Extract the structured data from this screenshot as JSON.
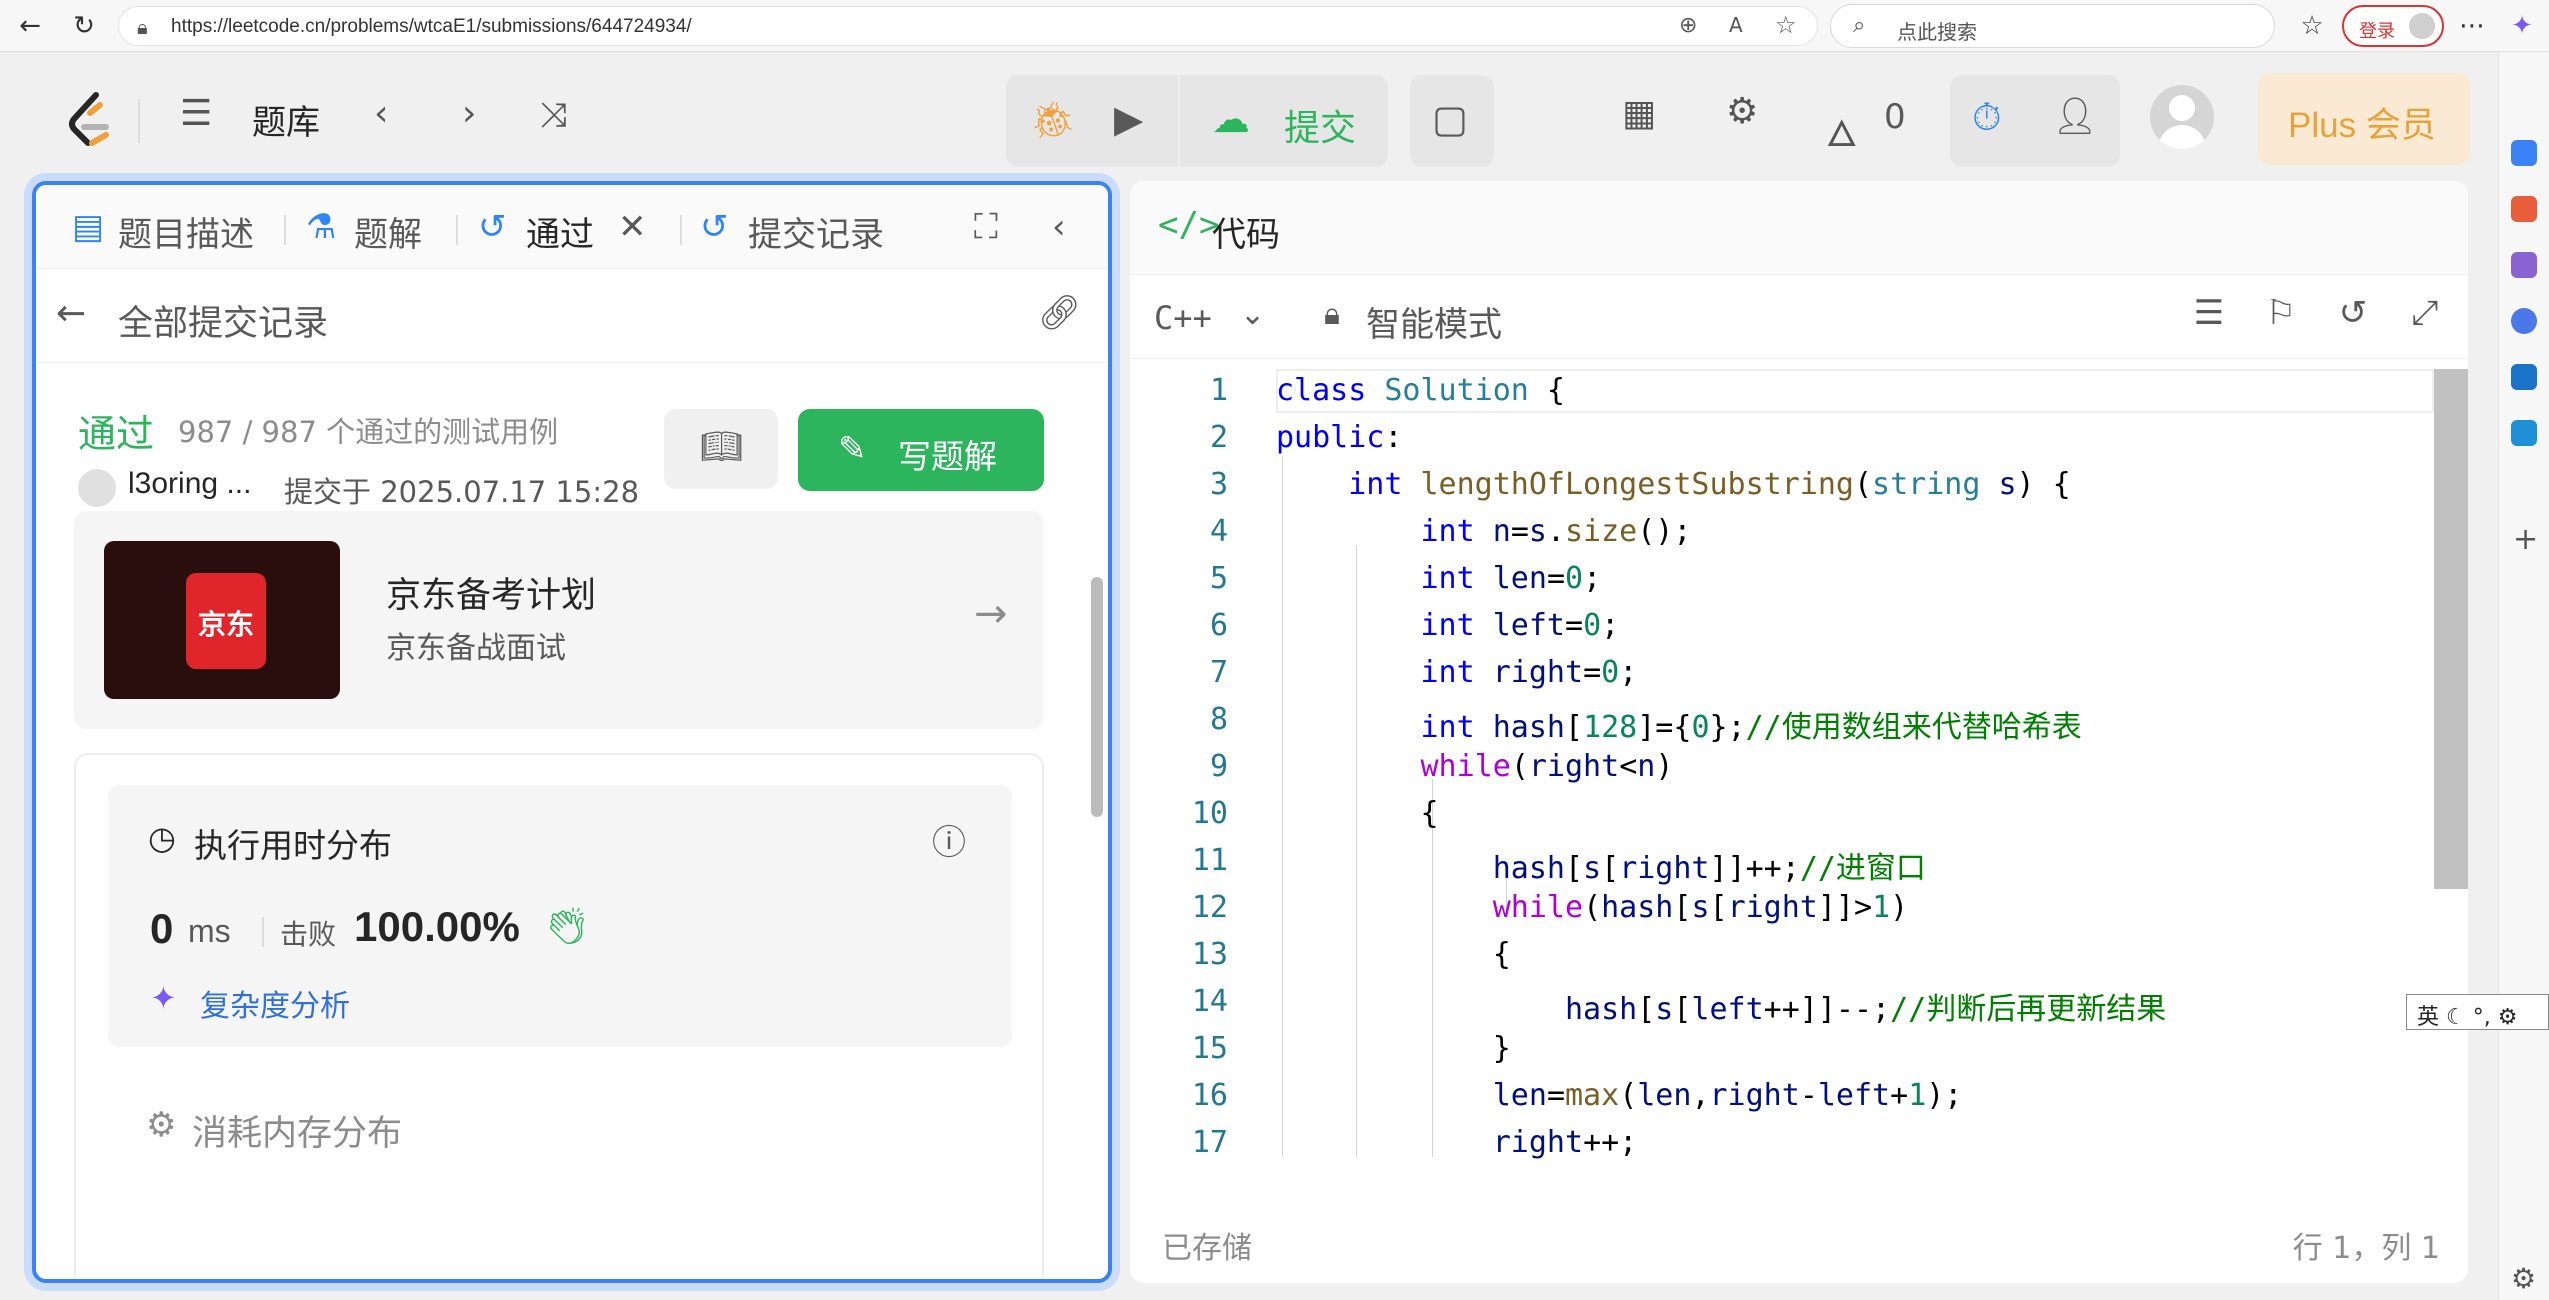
{
  "browser": {
    "url": "https://leetcode.cn/problems/wtcaE1/submissions/644724934/",
    "search_placeholder": "点此搜索",
    "login_label": "登录"
  },
  "topnav": {
    "problem_bank": "题库",
    "submit_label": "提交",
    "streak_count": "0",
    "plus_label": "Plus 会员"
  },
  "left": {
    "tabs": [
      {
        "label": "题目描述"
      },
      {
        "label": "题解"
      },
      {
        "label": "通过"
      },
      {
        "label": "提交记录"
      }
    ],
    "subhead": "全部提交记录",
    "status": "通过",
    "status_detail": "987 / 987 个通过的测试用例",
    "user": "l3oring ...",
    "submitted_at": "提交于 2025.07.17 15:28",
    "write_solution": "写题解",
    "ad": {
      "logo_text": "京东",
      "title": "京东备考计划",
      "subtitle": "京东备战面试"
    },
    "runtime": {
      "title": "执行用时分布",
      "value": "0",
      "unit": "ms",
      "beats_label": "击败",
      "beats_value": "100.00%",
      "complexity_link": "复杂度分析"
    },
    "memory": {
      "title": "消耗内存分布"
    }
  },
  "right": {
    "title": "代码",
    "language": "C++",
    "mode": "智能模式",
    "code_lines": [
      {
        "n": "1",
        "html": "<span class='kw'>class</span> <span class='ty'>Solution</span> {"
      },
      {
        "n": "2",
        "html": "<span class='kw'>public</span>:"
      },
      {
        "n": "3",
        "html": "    <span class='kw'>int</span> <span class='fn'>lengthOfLongestSubstring</span>(<span class='ty'>string</span> <span class='pm'>s</span>) {"
      },
      {
        "n": "4",
        "html": "        <span class='kw'>int</span> <span class='pm'>n</span>=<span class='pm'>s</span>.<span class='fn'>size</span>();"
      },
      {
        "n": "5",
        "html": "        <span class='kw'>int</span> <span class='pm'>len</span>=<span class='nm'>0</span>;"
      },
      {
        "n": "6",
        "html": "        <span class='kw'>int</span> <span class='pm'>left</span>=<span class='nm'>0</span>;"
      },
      {
        "n": "7",
        "html": "        <span class='kw'>int</span> <span class='pm'>right</span>=<span class='nm'>0</span>;"
      },
      {
        "n": "8",
        "html": "        <span class='kw'>int</span> <span class='pm'>hash</span>[<span class='nm'>128</span>]={<span class='nm'>0</span>};<span class='cm'>//使用数组来代替哈希表</span>"
      },
      {
        "n": "9",
        "html": "        <span class='ctl'>while</span>(<span class='pm'>right</span>&lt;<span class='pm'>n</span>)"
      },
      {
        "n": "10",
        "html": "        {"
      },
      {
        "n": "11",
        "html": "            <span class='pm'>hash</span>[<span class='pm'>s</span>[<span class='pm'>right</span>]]++;<span class='cm'>//进窗口</span>"
      },
      {
        "n": "12",
        "html": "            <span class='ctl'>while</span>(<span class='pm'>hash</span>[<span class='pm'>s</span>[<span class='pm'>right</span>]]&gt;<span class='nm'>1</span>)"
      },
      {
        "n": "13",
        "html": "            {"
      },
      {
        "n": "14",
        "html": "                <span class='pm'>hash</span>[<span class='pm'>s</span>[<span class='pm'>left</span>++]]--;<span class='cm'>//判断后再更新结果</span>"
      },
      {
        "n": "15",
        "html": "            }"
      },
      {
        "n": "16",
        "html": "            <span class='pm'>len</span>=<span class='fn'>max</span>(<span class='pm'>len</span>,<span class='pm'>right</span>-<span class='pm'>left</span>+<span class='nm'>1</span>);"
      },
      {
        "n": "17",
        "html": "            <span class='pm'>right</span>++;"
      }
    ],
    "saved_status": "已存储",
    "cursor_pos": "行 1，列 1"
  },
  "ime": {
    "lang": "英"
  }
}
